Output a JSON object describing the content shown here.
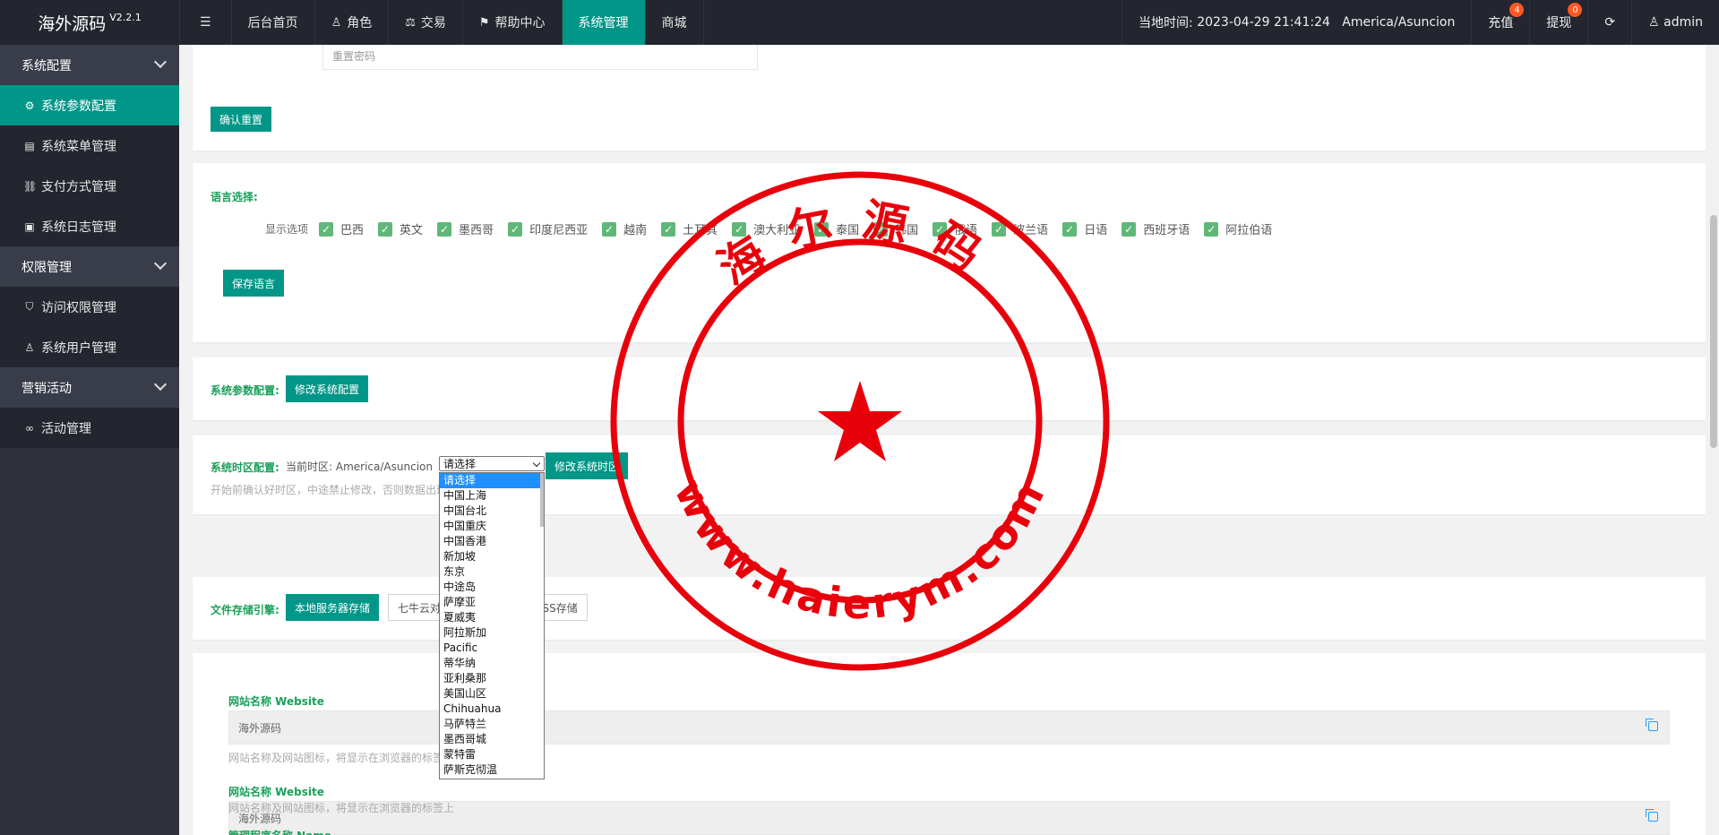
{
  "app": {
    "name": "海外源码",
    "version": "V2.2.1"
  },
  "nav": [
    {
      "label": "后台首页",
      "icon": ""
    },
    {
      "label": "角色",
      "icon": "user-icon"
    },
    {
      "label": "交易",
      "icon": "scale-icon"
    },
    {
      "label": "帮助中心",
      "icon": "flag-icon"
    },
    {
      "label": "系统管理",
      "icon": "",
      "active": true
    },
    {
      "label": "商城",
      "icon": ""
    }
  ],
  "header": {
    "time_label": "当地时间:",
    "time_value": "2023-04-29 21:41:24",
    "timezone": "America/Asuncion",
    "recharge_label": "充值",
    "recharge_badge": "4",
    "withdraw_label": "提现",
    "withdraw_badge": "0",
    "user_label": "admin"
  },
  "sidebar": {
    "groups": [
      {
        "label": "系统配置",
        "items": [
          {
            "label": "系统参数配置",
            "icon": "gear-icon",
            "active": true
          },
          {
            "label": "系统菜单管理",
            "icon": "calendar-icon"
          },
          {
            "label": "支付方式管理",
            "icon": "link-icon"
          },
          {
            "label": "系统日志管理",
            "icon": "clipboard-icon"
          }
        ]
      },
      {
        "label": "权限管理",
        "items": [
          {
            "label": "访问权限管理",
            "icon": "shield-icon"
          },
          {
            "label": "系统用户管理",
            "icon": "user-icon"
          }
        ]
      },
      {
        "label": "营销活动",
        "items": [
          {
            "label": "活动管理",
            "icon": "infinity-icon"
          }
        ]
      }
    ]
  },
  "reset": {
    "placeholder": "重置密码",
    "button": "确认重置"
  },
  "language": {
    "title": "语言选择:",
    "show_label": "显示选项",
    "options": [
      "巴西",
      "英文",
      "墨西哥",
      "印度尼西亚",
      "越南",
      "土耳其",
      "澳大利亚",
      "泰国",
      "韩国",
      "俄语",
      "波兰语",
      "日语",
      "西班牙语",
      "阿拉伯语"
    ],
    "save_button": "保存语言"
  },
  "sysparam": {
    "label": "系统参数配置:",
    "button": "修改系统配置"
  },
  "timezone": {
    "label": "系统时区配置:",
    "current_prefix": "当前时区:",
    "current_value": "America/Asuncion",
    "select_value": "请选择",
    "button": "修改系统时区",
    "hint": "开始前确认好时区，中途禁止修改，否则数据出现错误",
    "options": [
      "请选择",
      "中国上海",
      "中国台北",
      "中国重庆",
      "中国香港",
      "新加坡",
      "东京",
      "中途岛",
      "萨摩亚",
      "夏威夷",
      "阿拉斯加",
      "Pacific",
      "蒂华纳",
      "亚利桑那",
      "美国山区",
      "Chihuahua",
      "马萨特兰",
      "墨西哥城",
      "蒙特雷",
      "萨斯克彻温"
    ]
  },
  "storage": {
    "label": "文件存储引擎:",
    "buttons": [
      "本地服务器存储",
      "七牛云对象存储",
      "阿里云OSS存储"
    ]
  },
  "website": {
    "fields": [
      {
        "label": "网站名称 Website",
        "value": "海外源码",
        "hint": "网站名称及网站图标，将显示在浏览器的标签上"
      },
      {
        "label": "网站名称 Website",
        "value": "海外源码",
        "hint": "网站名称及网站图标，将显示在浏览器的标签上"
      }
    ],
    "next_label": "管理程序名称 Name"
  },
  "stamp": {
    "top_text": "海尔源码",
    "bottom_text": "www.haierym.com",
    "color": "#e8000b"
  },
  "colors": {
    "accent": "#009688",
    "header_bg": "#23262e",
    "sidebar_bg": "#2f323b",
    "label_green": "#1aa05a",
    "badge": "#ff5722"
  }
}
